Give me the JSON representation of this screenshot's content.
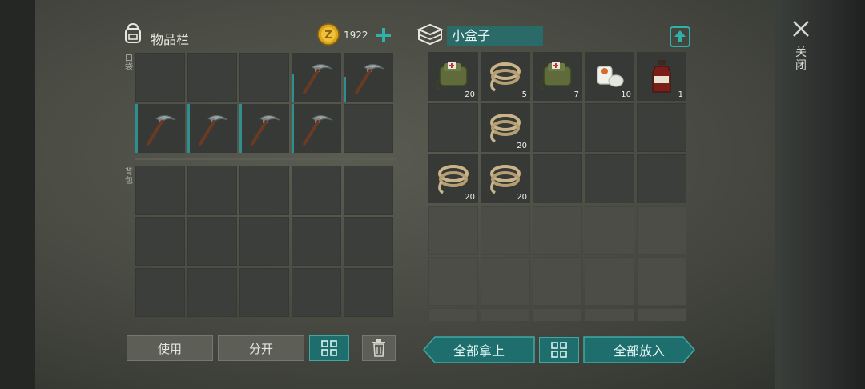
{
  "inventory": {
    "title": "物品栏",
    "coins": "1922",
    "pocket_label": "口袋",
    "backpack_label": "背包",
    "pocket_slots": [
      {
        "item": "empty"
      },
      {
        "item": "empty"
      },
      {
        "item": "empty"
      },
      {
        "item": "pickaxe",
        "durability": 0.55
      },
      {
        "item": "pickaxe",
        "durability": 0.5
      },
      {
        "item": "pickaxe",
        "durability": 1.0
      },
      {
        "item": "pickaxe",
        "durability": 1.0
      },
      {
        "item": "pickaxe",
        "durability": 1.0
      },
      {
        "item": "pickaxe",
        "durability": 1.0
      },
      {
        "item": "empty"
      }
    ],
    "backpack_slots": 15
  },
  "container": {
    "name": "小盒子",
    "slots": [
      {
        "item": "medkit-bag",
        "qty": "20"
      },
      {
        "item": "rope",
        "qty": "5"
      },
      {
        "item": "medkit-bag",
        "qty": "7"
      },
      {
        "item": "bandage",
        "qty": "10"
      },
      {
        "item": "bottle",
        "qty": "1"
      },
      {
        "item": "empty"
      },
      {
        "item": "rope",
        "qty": "20"
      },
      {
        "item": "empty"
      },
      {
        "item": "empty"
      },
      {
        "item": "empty"
      },
      {
        "item": "rope",
        "qty": "20"
      },
      {
        "item": "rope",
        "qty": "20"
      },
      {
        "item": "empty"
      },
      {
        "item": "empty"
      },
      {
        "item": "empty"
      }
    ],
    "locked_rows": 3
  },
  "buttons": {
    "use": "使用",
    "split": "分开",
    "take_all": "全部拿上",
    "put_all": "全部放入"
  },
  "close_label": "关闭",
  "colors": {
    "accent": "#2e8f8f",
    "teal_button": "#1d6e6c"
  }
}
